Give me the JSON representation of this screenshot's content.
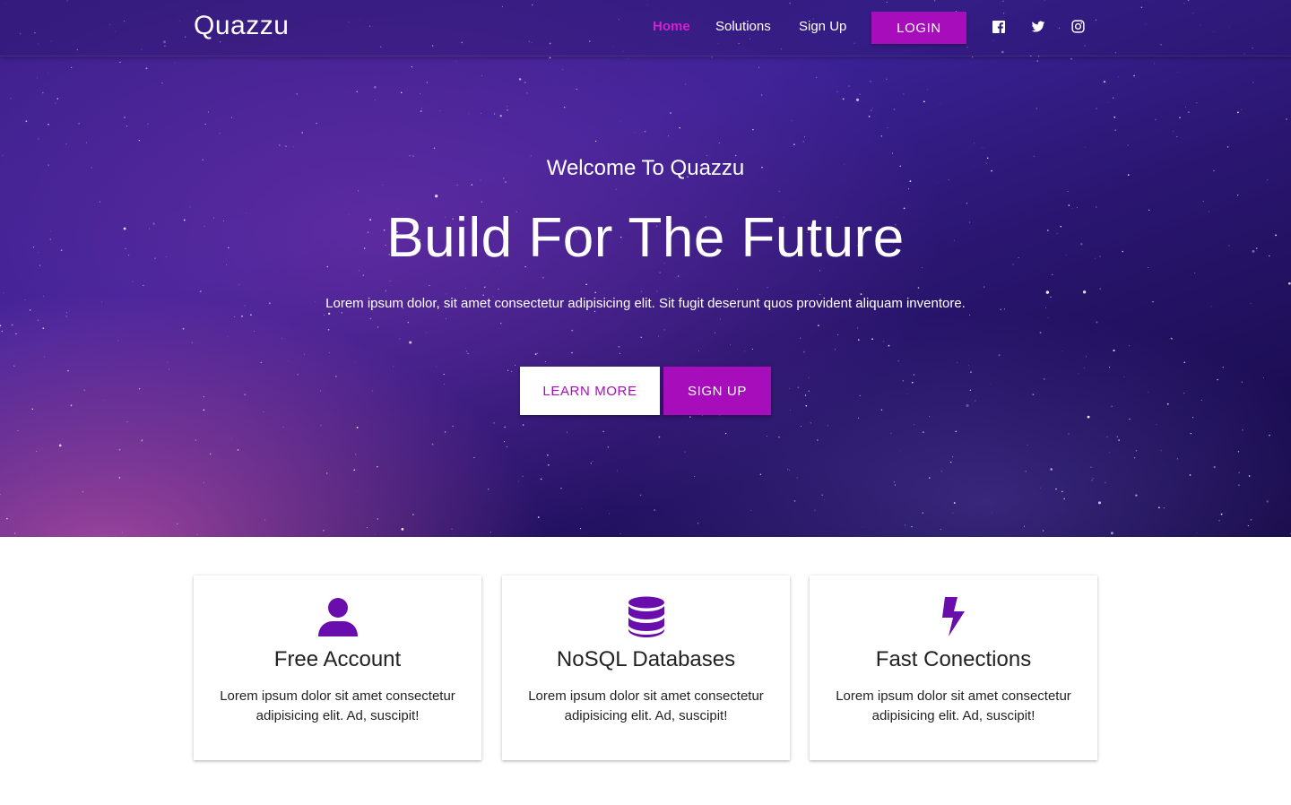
{
  "brand": "Quazzu",
  "nav": {
    "links": [
      {
        "label": "Home",
        "active": true
      },
      {
        "label": "Solutions",
        "active": false
      },
      {
        "label": "Sign Up",
        "active": false
      }
    ],
    "login_label": "LOGIN",
    "social_icons": [
      "facebook-icon",
      "twitter-icon",
      "instagram-icon"
    ]
  },
  "hero": {
    "subtitle": "Welcome To Quazzu",
    "title": "Build For The Future",
    "text": "Lorem ipsum dolor, sit amet consectetur adipisicing elit. Sit fugit deserunt quos provident aliquam inventore.",
    "learn_more_label": "LEARN MORE",
    "sign_up_label": "SIGN UP"
  },
  "cards": [
    {
      "icon": "user-icon",
      "title": "Free Account",
      "text": "Lorem ipsum dolor sit amet consectetur adipisicing elit. Ad, suscipit!"
    },
    {
      "icon": "database-icon",
      "title": "NoSQL Databases",
      "text": "Lorem ipsum dolor sit amet consectetur adipisicing elit. Ad, suscipit!"
    },
    {
      "icon": "bolt-icon",
      "title": "Fast Conections",
      "text": "Lorem ipsum dolor sit amet consectetur adipisicing elit. Ad, suscipit!"
    }
  ],
  "colors": {
    "accent": "#a80dbb",
    "active_link": "#d61fd0",
    "icon": "#6a0dad"
  }
}
